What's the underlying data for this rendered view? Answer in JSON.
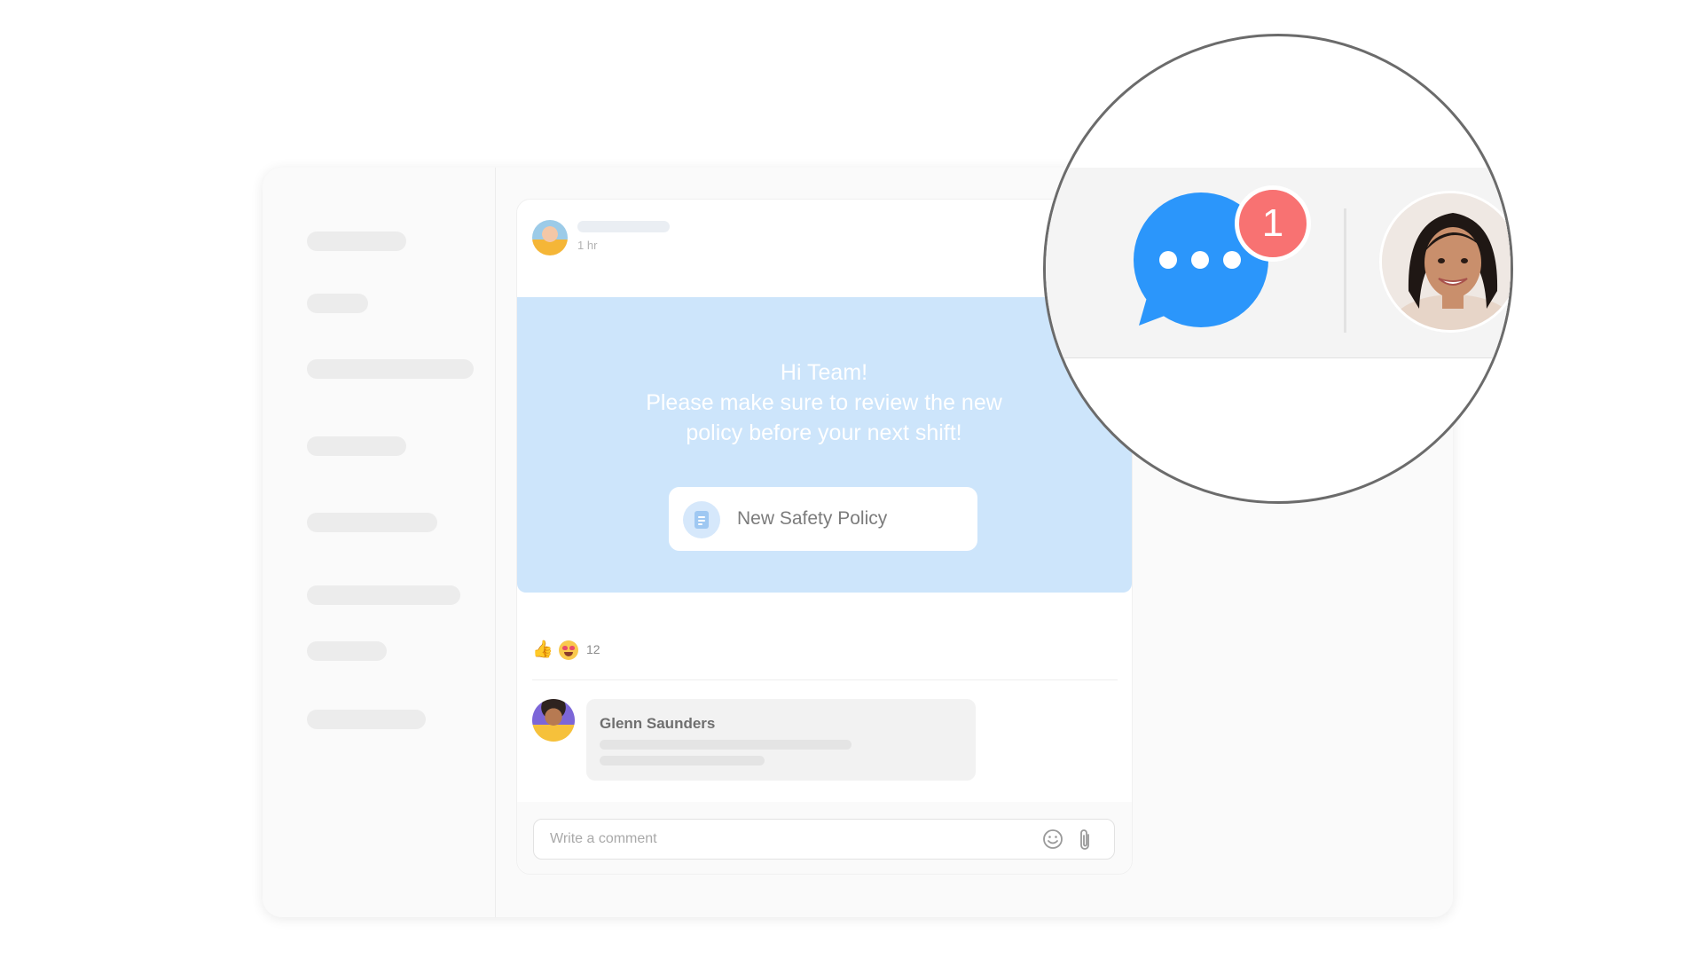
{
  "post": {
    "time": "1 hr",
    "greeting": "Hi Team!",
    "message_line1": "Please make sure to review the new",
    "message_line2": "policy before your next shift!",
    "attachment_label": "New Safety Policy",
    "reaction_count": "12"
  },
  "comment": {
    "author": "Glenn Saunders"
  },
  "comment_input": {
    "placeholder": "Write a comment"
  },
  "notification": {
    "unread_count": "1"
  },
  "colors": {
    "accent_blue": "#2b96fb",
    "badge_red": "#f87272",
    "banner_blue": "#cde5fb"
  },
  "icons": [
    "chat-bubble-icon",
    "document-icon",
    "thumbs-up-icon",
    "heart-eyes-emoji-icon",
    "emoji-icon",
    "paperclip-icon"
  ]
}
